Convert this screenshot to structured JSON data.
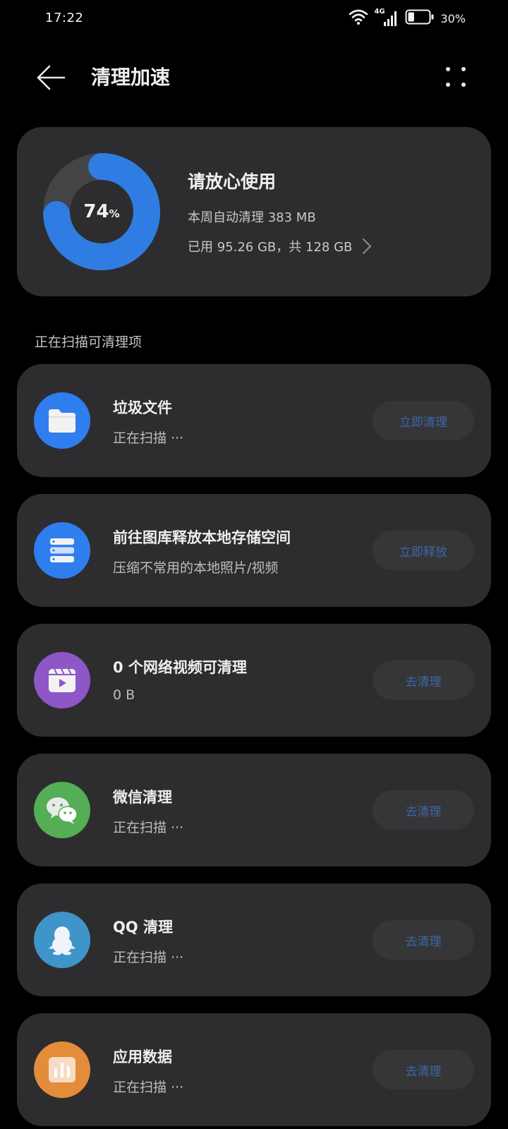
{
  "status_bar": {
    "time": "17:22",
    "network": "4G",
    "battery_percent": "30%",
    "battery_level": 0.3,
    "icons": [
      "wifi-icon",
      "cellular-signal-icon",
      "battery-icon"
    ]
  },
  "header": {
    "title": "清理加速",
    "back_icon": "back-arrow-icon",
    "more_icon": "more-dots-icon"
  },
  "storage": {
    "percent_value": "74",
    "percent_unit": "%",
    "used_fraction": 0.74,
    "title": "请放心使用",
    "auto_clean": "本周自动清理 383 MB",
    "usage": "已用 95.26 GB，共 128 GB",
    "ring_color": "#2f7de3",
    "ring_track_color": "#444446"
  },
  "section": {
    "scanning_label": "正在扫描可清理项"
  },
  "items": [
    {
      "title": "垃圾文件",
      "subtitle": "正在扫描 ···",
      "button": "立即清理",
      "icon": "folder-icon",
      "icon_color": "#2f7ef0"
    },
    {
      "title": "前往图库释放本地存储空间",
      "subtitle": "压缩不常用的本地照片/视频",
      "button": "立即释放",
      "icon": "storage-icon",
      "icon_color": "#2f7ef0"
    },
    {
      "title": "0 个网络视频可清理",
      "subtitle": "0 B",
      "button": "去清理",
      "icon": "video-icon",
      "icon_color": "#8f56c6"
    },
    {
      "title": "微信清理",
      "subtitle": "正在扫描 ···",
      "button": "去清理",
      "icon": "wechat-icon",
      "icon_color": "#55ad55"
    },
    {
      "title": "QQ 清理",
      "subtitle": "正在扫描 ···",
      "button": "去清理",
      "icon": "qq-penguin-icon",
      "icon_color": "#3f94c9"
    },
    {
      "title": "应用数据",
      "subtitle": "正在扫描 ···",
      "button": "去清理",
      "icon": "app-data-icon",
      "icon_color": "#e38c3a"
    }
  ],
  "colors": {
    "background": "#000000",
    "card": "#2d2d2f",
    "button_bg": "#363638",
    "button_text": "#3d67a8"
  }
}
